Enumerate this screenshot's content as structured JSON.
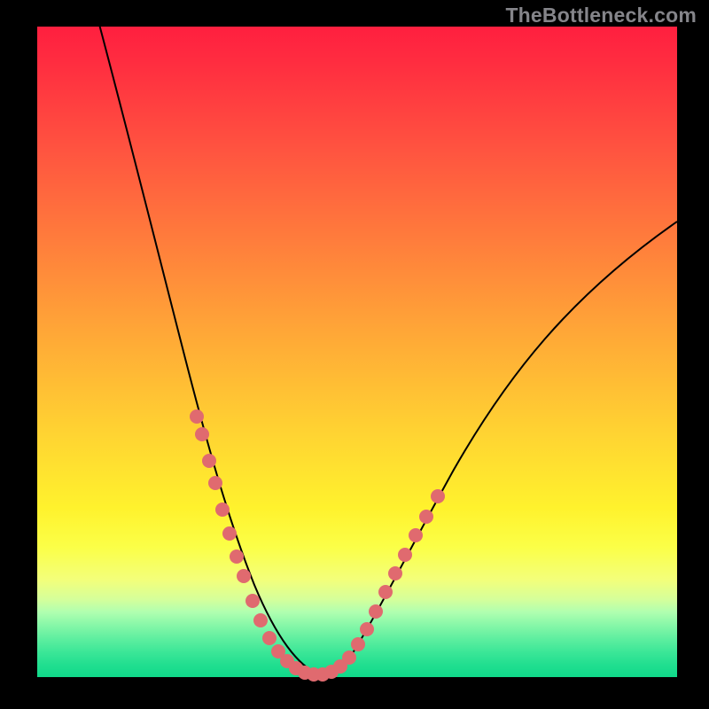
{
  "watermark": "TheBottleneck.com",
  "colors": {
    "background": "#000000",
    "dot": "#e06a6f",
    "curve": "#000000",
    "gradient_top": "#ff1f3f",
    "gradient_bottom": "#10d98a"
  },
  "chart_data": {
    "type": "line",
    "title": "",
    "xlabel": "",
    "ylabel": "",
    "xlim": [
      0,
      100
    ],
    "ylim": [
      0,
      100
    ],
    "x": [
      0,
      5,
      10,
      15,
      20,
      25,
      28,
      30,
      32,
      34,
      36,
      38,
      40,
      42,
      44,
      45,
      50,
      55,
      60,
      65,
      70,
      75,
      80,
      85,
      90,
      95,
      100
    ],
    "values": [
      132,
      110,
      89,
      70,
      52,
      36,
      27,
      21,
      16,
      11,
      7,
      4,
      2,
      1,
      0,
      0,
      5,
      12,
      20,
      29,
      37,
      44,
      51,
      57,
      63,
      68,
      73
    ],
    "series": [
      {
        "name": "left-branch-markers",
        "x": [
          24.5,
          25.5,
          27,
          27.5,
          28.5,
          30,
          31,
          32,
          33.5,
          34.5
        ],
        "values": [
          38,
          35,
          30,
          28,
          25,
          21,
          18,
          16,
          12,
          10
        ]
      },
      {
        "name": "right-branch-markers",
        "x": [
          50,
          51,
          52,
          53,
          54,
          55,
          56.5,
          58,
          60,
          62
        ],
        "values": [
          5,
          6.5,
          8,
          9.5,
          11,
          13,
          15,
          17.5,
          21,
          24
        ]
      },
      {
        "name": "bottom-cluster-markers",
        "x": [
          36,
          37,
          38,
          39,
          40,
          41,
          42,
          43,
          44,
          45,
          46,
          47
        ],
        "values": [
          7,
          5.5,
          4,
          3,
          2,
          1.3,
          0.8,
          0.5,
          0.3,
          0.3,
          0.8,
          1.5
        ]
      }
    ]
  }
}
